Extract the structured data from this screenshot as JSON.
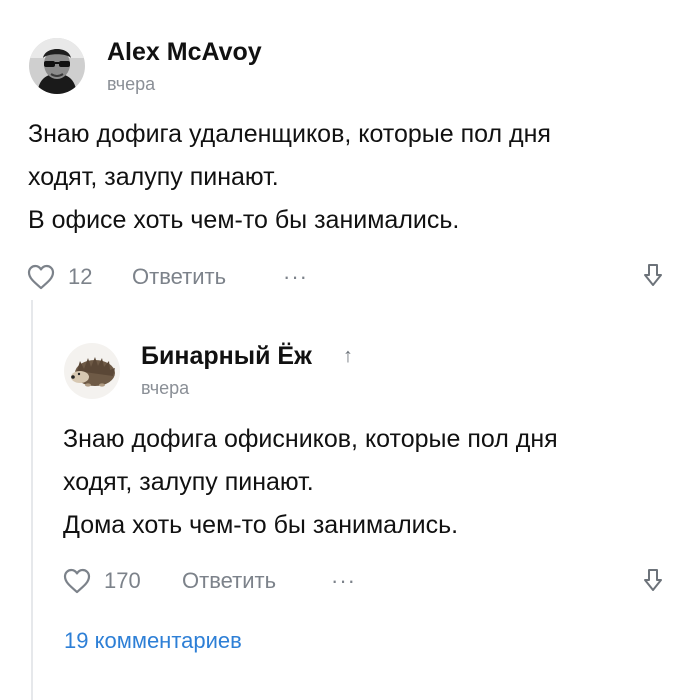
{
  "comment": {
    "author": "Alex McAvoy",
    "time": "вчера",
    "text_lines": [
      "Знаю дофига удаленщиков, которые пол дня",
      "ходят, залупу пинают.",
      "В офисе хоть чем-то бы занимались."
    ],
    "likes": "12",
    "reply_label": "Ответить",
    "more_label": "···"
  },
  "reply": {
    "author": "Бинарный Ёж",
    "reply_to_icon": "↑",
    "time": "вчера",
    "text_lines": [
      "Знаю дофига офисников, которые пол дня",
      "ходят, залупу пинают.",
      "Дома хоть чем-то бы занимались."
    ],
    "likes": "170",
    "reply_label": "Ответить",
    "more_label": "···"
  },
  "thread": {
    "more_comments_label": "19 комментариев"
  },
  "colors": {
    "text": "#111111",
    "muted": "#7c828a",
    "link": "#2d7fd6",
    "thread_line": "#e6e8eb"
  },
  "icons": {
    "like": "heart-icon",
    "more": "ellipsis-icon",
    "downvote": "arrow-down-icon",
    "reply_to": "arrow-up-icon"
  }
}
